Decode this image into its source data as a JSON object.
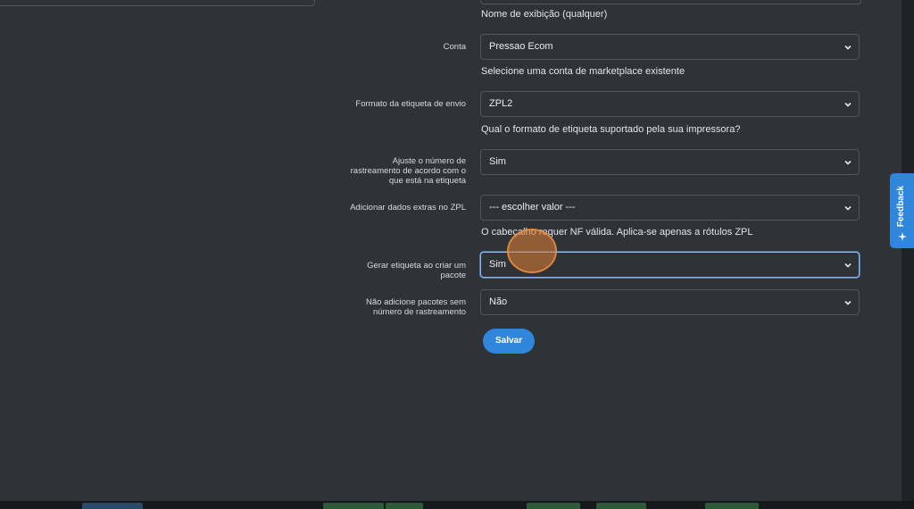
{
  "form": {
    "display_name_help": "Nome de exibição (qualquer)",
    "account": {
      "label": "Conta",
      "value": "Pressao Ecom",
      "help": "Selecione uma conta de marketplace existente"
    },
    "label_format": {
      "label": "Formato da etiqueta de envio",
      "value": "ZPL2",
      "help": "Qual o formato de etiqueta suportado pela sua impressora?"
    },
    "tracking_adjust": {
      "label_lines": [
        "Ajuste o número de",
        "rastreamento de acordo com o",
        "que está na etiqueta"
      ],
      "value": "Sim"
    },
    "extra_zpl": {
      "label": "Adicionar dados extras no ZPL",
      "value": "--- escolher valor ---",
      "help": "O cabeçalho requer NF válida. Aplica-se apenas a rótulos ZPL"
    },
    "generate_label": {
      "label_lines": [
        "Gerar etiqueta ao criar um",
        "pacote"
      ],
      "value": "Sim"
    },
    "skip_no_tracking": {
      "label_lines": [
        "Não adicione pacotes sem",
        "número de rastreamento"
      ],
      "value": "Não"
    },
    "save_label": "Salvar"
  },
  "feedback_tab": {
    "label": "Feedback",
    "icon": "sparkle-icon"
  },
  "colors": {
    "background": "#2f3337",
    "accent": "#2f86db",
    "focus_border": "#8ab8ec",
    "cursor_highlight": "#d67834"
  }
}
